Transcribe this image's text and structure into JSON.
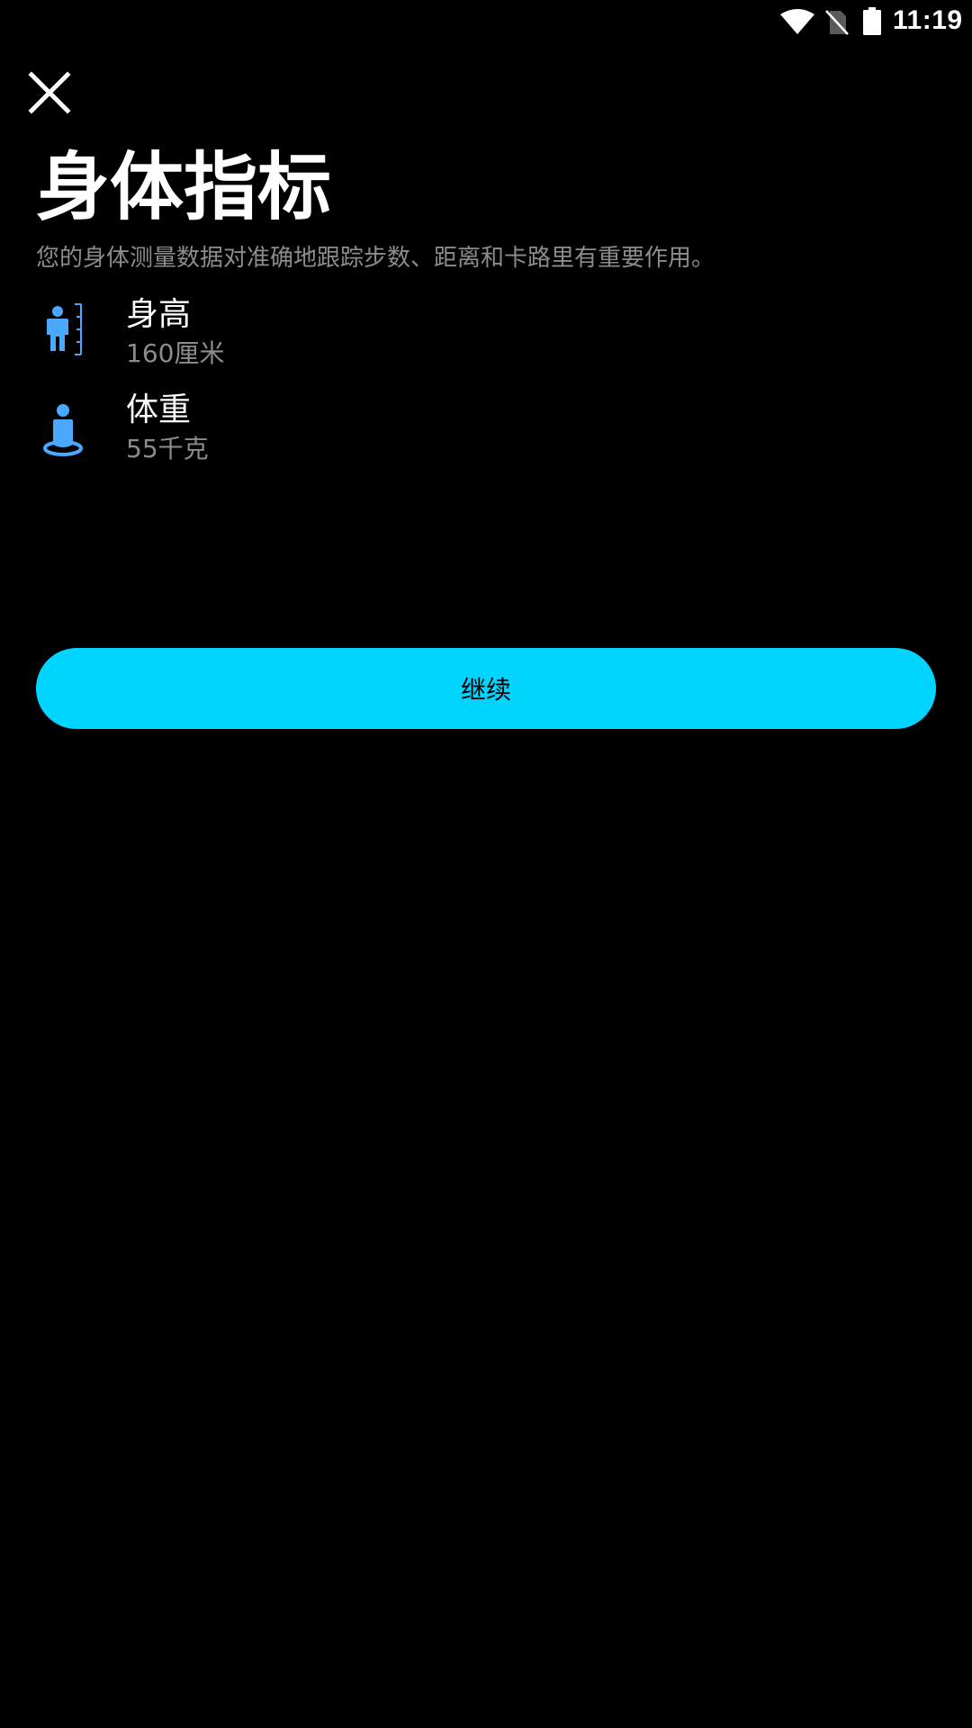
{
  "status_bar": {
    "time": "11:19",
    "icons": [
      "wifi-icon",
      "no-sim-icon",
      "battery-icon"
    ]
  },
  "header": {
    "close_icon": "close-icon",
    "title": "身体指标",
    "subtitle": "您的身体测量数据对准确地跟踪步数、距离和卡路里有重要作用。"
  },
  "metrics": [
    {
      "icon": "height-person-icon",
      "label": "身高",
      "value": "160厘米"
    },
    {
      "icon": "weight-person-icon",
      "label": "体重",
      "value": "55千克"
    }
  ],
  "actions": {
    "continue_label": "继续"
  },
  "colors": {
    "background": "#000000",
    "accent": "#00d4ff",
    "icon_blue": "#4aa8ff",
    "secondary_text": "#8c8c8c"
  }
}
